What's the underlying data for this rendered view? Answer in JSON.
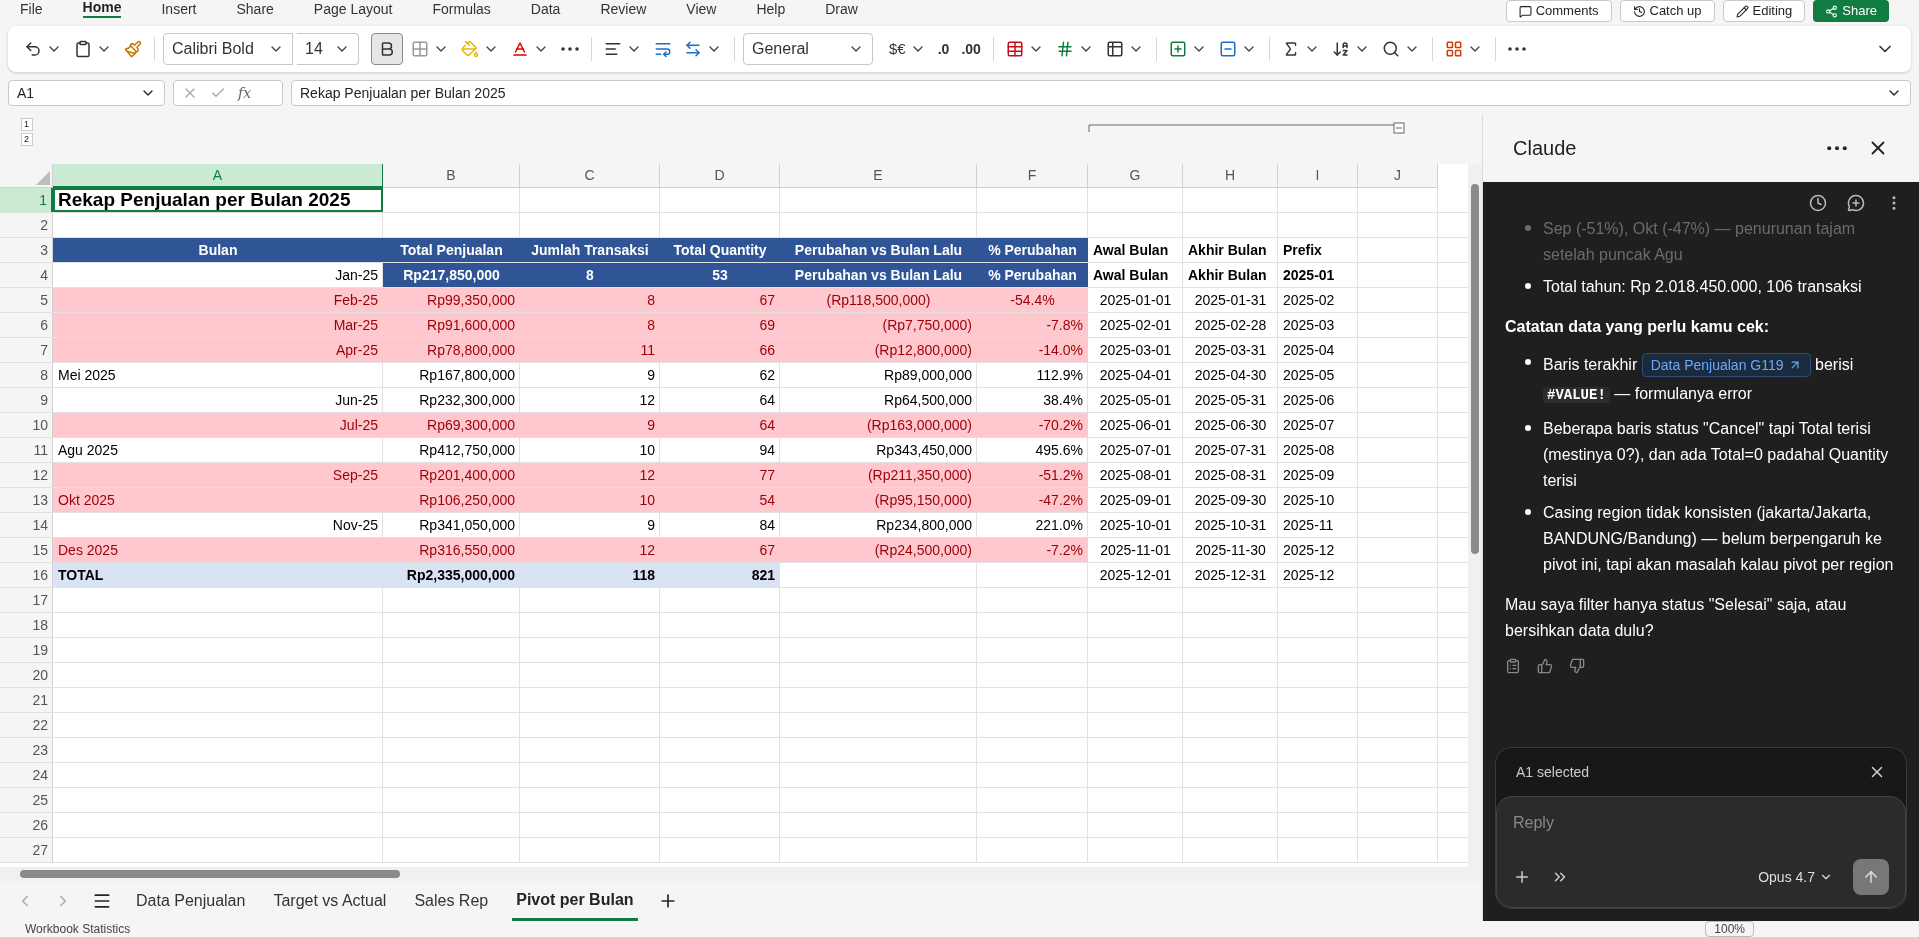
{
  "ribbon_tabs": [
    {
      "label": "File",
      "selected": false
    },
    {
      "label": "Home",
      "selected": true
    },
    {
      "label": "Insert",
      "selected": false
    },
    {
      "label": "Share",
      "selected": false
    },
    {
      "label": "Page Layout",
      "selected": false
    },
    {
      "label": "Formulas",
      "selected": false
    },
    {
      "label": "Data",
      "selected": false
    },
    {
      "label": "Review",
      "selected": false
    },
    {
      "label": "View",
      "selected": false
    },
    {
      "label": "Help",
      "selected": false
    },
    {
      "label": "Draw",
      "selected": false
    }
  ],
  "top_buttons": [
    {
      "label": "Comments",
      "kind": "comments"
    },
    {
      "label": "Catch up",
      "kind": "catchup"
    },
    {
      "label": "Editing",
      "kind": "editing"
    },
    {
      "label": "Share",
      "kind": "share"
    }
  ],
  "toolbar": {
    "font": "Calibri Bold",
    "size": "14",
    "bold": true,
    "number_format": "General",
    "currency": "$€",
    "decrease_decimal": ".0",
    "increase_decimal": ".00"
  },
  "formula_bar": {
    "name_box": "A1",
    "function_label": "fx",
    "formula": "Rekap Penjualan per Bulan 2025"
  },
  "outline_levels": [
    "1",
    "2"
  ],
  "columns": [
    {
      "label": "A",
      "selected": true
    },
    {
      "label": "B",
      "selected": false
    },
    {
      "label": "C",
      "selected": false
    },
    {
      "label": "D",
      "selected": false
    },
    {
      "label": "E",
      "selected": false
    },
    {
      "label": "F",
      "selected": false
    },
    {
      "label": "G",
      "selected": false
    },
    {
      "label": "H",
      "selected": false
    },
    {
      "label": "I",
      "selected": false
    },
    {
      "label": "J",
      "selected": false
    }
  ],
  "rows": [
    {
      "number": "1",
      "selected": true,
      "highlight": false,
      "total": false,
      "cells": [
        {
          "kind": "title",
          "text": "Rekap Penjualan per Bulan 2025"
        }
      ]
    },
    {
      "number": "2",
      "selected": false,
      "highlight": false,
      "total": false,
      "cells": []
    },
    {
      "number": "3",
      "selected": false,
      "highlight": false,
      "total": false,
      "cells": [
        {
          "kind": "header",
          "text": "Bulan"
        },
        {
          "kind": "header",
          "text": "Total Penjualan"
        },
        {
          "kind": "header",
          "text": "Jumlah Transaksi"
        },
        {
          "kind": "header",
          "text": "Total Quantity"
        },
        {
          "kind": "header",
          "text": "Perubahan vs Bulan Lalu"
        },
        {
          "kind": "header",
          "text": "% Perubahan"
        },
        {
          "kind": "bold_text",
          "text": "Awal Bulan"
        },
        {
          "kind": "bold_text",
          "text": "Akhir Bulan"
        },
        {
          "kind": "bold_text",
          "text": "Prefix"
        }
      ]
    },
    {
      "number": "4",
      "selected": false,
      "highlight": false,
      "total": false,
      "cells": [
        {
          "kind": "number",
          "text": "Jan-25"
        },
        {
          "kind": "header",
          "text": "Rp217,850,000"
        },
        {
          "kind": "header",
          "text": "8"
        },
        {
          "kind": "header",
          "text": "53"
        },
        {
          "kind": "header",
          "text": "Perubahan vs Bulan Lalu"
        },
        {
          "kind": "header",
          "text": "% Perubahan"
        },
        {
          "kind": "bold_text",
          "text": "Awal Bulan"
        },
        {
          "kind": "bold_text",
          "text": "Akhir Bulan"
        },
        {
          "kind": "bold_text",
          "text": "2025-01"
        }
      ]
    },
    {
      "number": "5",
      "selected": false,
      "highlight": true,
      "total": false,
      "cells": [
        {
          "kind": "number",
          "text": "Feb-25"
        },
        {
          "kind": "number",
          "text": "Rp99,350,000"
        },
        {
          "kind": "number",
          "text": "8"
        },
        {
          "kind": "number",
          "text": "67"
        },
        {
          "kind": "center",
          "text": "(Rp118,500,000)"
        },
        {
          "kind": "center",
          "text": "-54.4%"
        },
        {
          "kind": "center",
          "text": "2025-01-01"
        },
        {
          "kind": "center",
          "text": "2025-01-31"
        },
        {
          "kind": "text",
          "text": "2025-02"
        }
      ]
    },
    {
      "number": "6",
      "selected": false,
      "highlight": true,
      "total": false,
      "cells": [
        {
          "kind": "number",
          "text": "Mar-25"
        },
        {
          "kind": "number",
          "text": "Rp91,600,000"
        },
        {
          "kind": "number",
          "text": "8"
        },
        {
          "kind": "number",
          "text": "69"
        },
        {
          "kind": "number",
          "text": "(Rp7,750,000)"
        },
        {
          "kind": "number",
          "text": "-7.8%"
        },
        {
          "kind": "center",
          "text": "2025-02-01"
        },
        {
          "kind": "center",
          "text": "2025-02-28"
        },
        {
          "kind": "text",
          "text": "2025-03"
        }
      ]
    },
    {
      "number": "7",
      "selected": false,
      "highlight": true,
      "total": false,
      "cells": [
        {
          "kind": "number",
          "text": "Apr-25"
        },
        {
          "kind": "number",
          "text": "Rp78,800,000"
        },
        {
          "kind": "number",
          "text": "11"
        },
        {
          "kind": "number",
          "text": "66"
        },
        {
          "kind": "number",
          "text": "(Rp12,800,000)"
        },
        {
          "kind": "number",
          "text": "-14.0%"
        },
        {
          "kind": "center",
          "text": "2025-03-01"
        },
        {
          "kind": "center",
          "text": "2025-03-31"
        },
        {
          "kind": "text",
          "text": "2025-04"
        }
      ]
    },
    {
      "number": "8",
      "selected": false,
      "highlight": false,
      "total": false,
      "cells": [
        {
          "kind": "text",
          "text": "Mei 2025"
        },
        {
          "kind": "number",
          "text": "Rp167,800,000"
        },
        {
          "kind": "number",
          "text": "9"
        },
        {
          "kind": "number",
          "text": "62"
        },
        {
          "kind": "number",
          "text": "Rp89,000,000"
        },
        {
          "kind": "number",
          "text": "112.9%"
        },
        {
          "kind": "center",
          "text": "2025-04-01"
        },
        {
          "kind": "center",
          "text": "2025-04-30"
        },
        {
          "kind": "text",
          "text": "2025-05"
        }
      ]
    },
    {
      "number": "9",
      "selected": false,
      "highlight": false,
      "total": false,
      "cells": [
        {
          "kind": "number",
          "text": "Jun-25"
        },
        {
          "kind": "number",
          "text": "Rp232,300,000"
        },
        {
          "kind": "number",
          "text": "12"
        },
        {
          "kind": "number",
          "text": "64"
        },
        {
          "kind": "number",
          "text": "Rp64,500,000"
        },
        {
          "kind": "number",
          "text": "38.4%"
        },
        {
          "kind": "center",
          "text": "2025-05-01"
        },
        {
          "kind": "center",
          "text": "2025-05-31"
        },
        {
          "kind": "text",
          "text": "2025-06"
        }
      ]
    },
    {
      "number": "10",
      "selected": false,
      "highlight": true,
      "total": false,
      "cells": [
        {
          "kind": "number",
          "text": "Jul-25"
        },
        {
          "kind": "number",
          "text": "Rp69,300,000"
        },
        {
          "kind": "number",
          "text": "9"
        },
        {
          "kind": "number",
          "text": "64"
        },
        {
          "kind": "number",
          "text": "(Rp163,000,000)"
        },
        {
          "kind": "number",
          "text": "-70.2%"
        },
        {
          "kind": "center",
          "text": "2025-06-01"
        },
        {
          "kind": "center",
          "text": "2025-06-30"
        },
        {
          "kind": "text",
          "text": "2025-07"
        }
      ]
    },
    {
      "number": "11",
      "selected": false,
      "highlight": false,
      "total": false,
      "cells": [
        {
          "kind": "text",
          "text": "Agu 2025"
        },
        {
          "kind": "number",
          "text": "Rp412,750,000"
        },
        {
          "kind": "number",
          "text": "10"
        },
        {
          "kind": "number",
          "text": "94"
        },
        {
          "kind": "number",
          "text": "Rp343,450,000"
        },
        {
          "kind": "number",
          "text": "495.6%"
        },
        {
          "kind": "center",
          "text": "2025-07-01"
        },
        {
          "kind": "center",
          "text": "2025-07-31"
        },
        {
          "kind": "text",
          "text": "2025-08"
        }
      ]
    },
    {
      "number": "12",
      "selected": false,
      "highlight": true,
      "total": false,
      "cells": [
        {
          "kind": "number",
          "text": "Sep-25"
        },
        {
          "kind": "number",
          "text": "Rp201,400,000"
        },
        {
          "kind": "number",
          "text": "12"
        },
        {
          "kind": "number",
          "text": "77"
        },
        {
          "kind": "number",
          "text": "(Rp211,350,000)"
        },
        {
          "kind": "number",
          "text": "-51.2%"
        },
        {
          "kind": "center",
          "text": "2025-08-01"
        },
        {
          "kind": "center",
          "text": "2025-08-31"
        },
        {
          "kind": "text",
          "text": "2025-09"
        }
      ]
    },
    {
      "number": "13",
      "selected": false,
      "highlight": true,
      "total": false,
      "cells": [
        {
          "kind": "text",
          "text": "Okt 2025"
        },
        {
          "kind": "number",
          "text": "Rp106,250,000"
        },
        {
          "kind": "number",
          "text": "10"
        },
        {
          "kind": "number",
          "text": "54"
        },
        {
          "kind": "number",
          "text": "(Rp95,150,000)"
        },
        {
          "kind": "number",
          "text": "-47.2%"
        },
        {
          "kind": "center",
          "text": "2025-09-01"
        },
        {
          "kind": "center",
          "text": "2025-09-30"
        },
        {
          "kind": "text",
          "text": "2025-10"
        }
      ]
    },
    {
      "number": "14",
      "selected": false,
      "highlight": false,
      "total": false,
      "cells": [
        {
          "kind": "number",
          "text": "Nov-25"
        },
        {
          "kind": "number",
          "text": "Rp341,050,000"
        },
        {
          "kind": "number",
          "text": "9"
        },
        {
          "kind": "number",
          "text": "84"
        },
        {
          "kind": "number",
          "text": "Rp234,800,000"
        },
        {
          "kind": "number",
          "text": "221.0%"
        },
        {
          "kind": "center",
          "text": "2025-10-01"
        },
        {
          "kind": "center",
          "text": "2025-10-31"
        },
        {
          "kind": "text",
          "text": "2025-11"
        }
      ]
    },
    {
      "number": "15",
      "selected": false,
      "highlight": true,
      "total": false,
      "cells": [
        {
          "kind": "text",
          "text": "Des 2025"
        },
        {
          "kind": "number",
          "text": "Rp316,550,000"
        },
        {
          "kind": "number",
          "text": "12"
        },
        {
          "kind": "number",
          "text": "67"
        },
        {
          "kind": "number",
          "text": "(Rp24,500,000)"
        },
        {
          "kind": "number",
          "text": "-7.2%"
        },
        {
          "kind": "center",
          "text": "2025-11-01"
        },
        {
          "kind": "center",
          "text": "2025-11-30"
        },
        {
          "kind": "text",
          "text": "2025-12"
        }
      ]
    },
    {
      "number": "16",
      "selected": false,
      "highlight": false,
      "total": true,
      "cells": [
        {
          "kind": "bold_text",
          "text": "TOTAL"
        },
        {
          "kind": "bold_number",
          "text": "Rp2,335,000,000"
        },
        {
          "kind": "bold_number",
          "text": "118"
        },
        {
          "kind": "bold_number",
          "text": "821"
        },
        {
          "kind": "empty"
        },
        {
          "kind": "empty"
        },
        {
          "kind": "center",
          "text": "2025-12-01"
        },
        {
          "kind": "center",
          "text": "2025-12-31"
        },
        {
          "kind": "text",
          "text": "2025-12"
        }
      ]
    },
    {
      "number": "17",
      "selected": false,
      "highlight": false,
      "total": false,
      "cells": []
    },
    {
      "number": "18",
      "selected": false,
      "highlight": false,
      "total": false,
      "cells": []
    },
    {
      "number": "19",
      "selected": false,
      "highlight": false,
      "total": false,
      "cells": []
    },
    {
      "number": "20",
      "selected": false,
      "highlight": false,
      "total": false,
      "cells": []
    },
    {
      "number": "21",
      "selected": false,
      "highlight": false,
      "total": false,
      "cells": []
    },
    {
      "number": "22",
      "selected": false,
      "highlight": false,
      "total": false,
      "cells": []
    },
    {
      "number": "23",
      "selected": false,
      "highlight": false,
      "total": false,
      "cells": []
    },
    {
      "number": "24",
      "selected": false,
      "highlight": false,
      "total": false,
      "cells": []
    },
    {
      "number": "25",
      "selected": false,
      "highlight": false,
      "total": false,
      "cells": []
    },
    {
      "number": "26",
      "selected": false,
      "highlight": false,
      "total": false,
      "cells": []
    },
    {
      "number": "27",
      "selected": false,
      "highlight": false,
      "total": false,
      "cells": []
    }
  ],
  "sheet_tabs": [
    {
      "label": "Data Penjualan",
      "selected": false
    },
    {
      "label": "Target vs Actual",
      "selected": false
    },
    {
      "label": "Sales Rep",
      "selected": false
    },
    {
      "label": "Pivot per Bulan",
      "selected": true
    }
  ],
  "assistant": {
    "title": "Claude",
    "blocks": [
      {
        "kind": "bullet",
        "faded": true,
        "text": "Sep (-51%), Okt (-47%) — penurunan tajam setelah puncak Agu"
      },
      {
        "kind": "bullet",
        "faded": false,
        "text": "Total tahun: Rp 2.018.450.000, 106 transaksi"
      },
      {
        "kind": "heading",
        "text": "Catatan data yang perlu kamu cek:"
      },
      {
        "kind": "bullet_ref",
        "before": "Baris terakhir",
        "link": "Data Penjualan G119",
        "middle": "berisi",
        "code": "#VALUE!",
        "after": "— formulanya error"
      },
      {
        "kind": "bullet",
        "faded": false,
        "text": "Beberapa baris status \"Cancel\" tapi Total terisi (mestinya 0?), dan ada Total=0 padahal Quantity terisi"
      },
      {
        "kind": "bullet",
        "faded": false,
        "text": "Casing region tidak konsisten (jakarta/Jakarta, BANDUNG/Bandung) — belum berpengaruh ke pivot ini, tapi akan masalah kalau pivot per region"
      },
      {
        "kind": "paragraph",
        "text": "Mau saya filter hanya status \"Selesai\" saja, atau bersihkan data dulu?"
      }
    ],
    "context": "A1 selected",
    "reply_placeholder": "Reply",
    "model": "Opus 4.7"
  },
  "status_bar": {
    "left": "Workbook Statistics",
    "zoom": "100%"
  }
}
